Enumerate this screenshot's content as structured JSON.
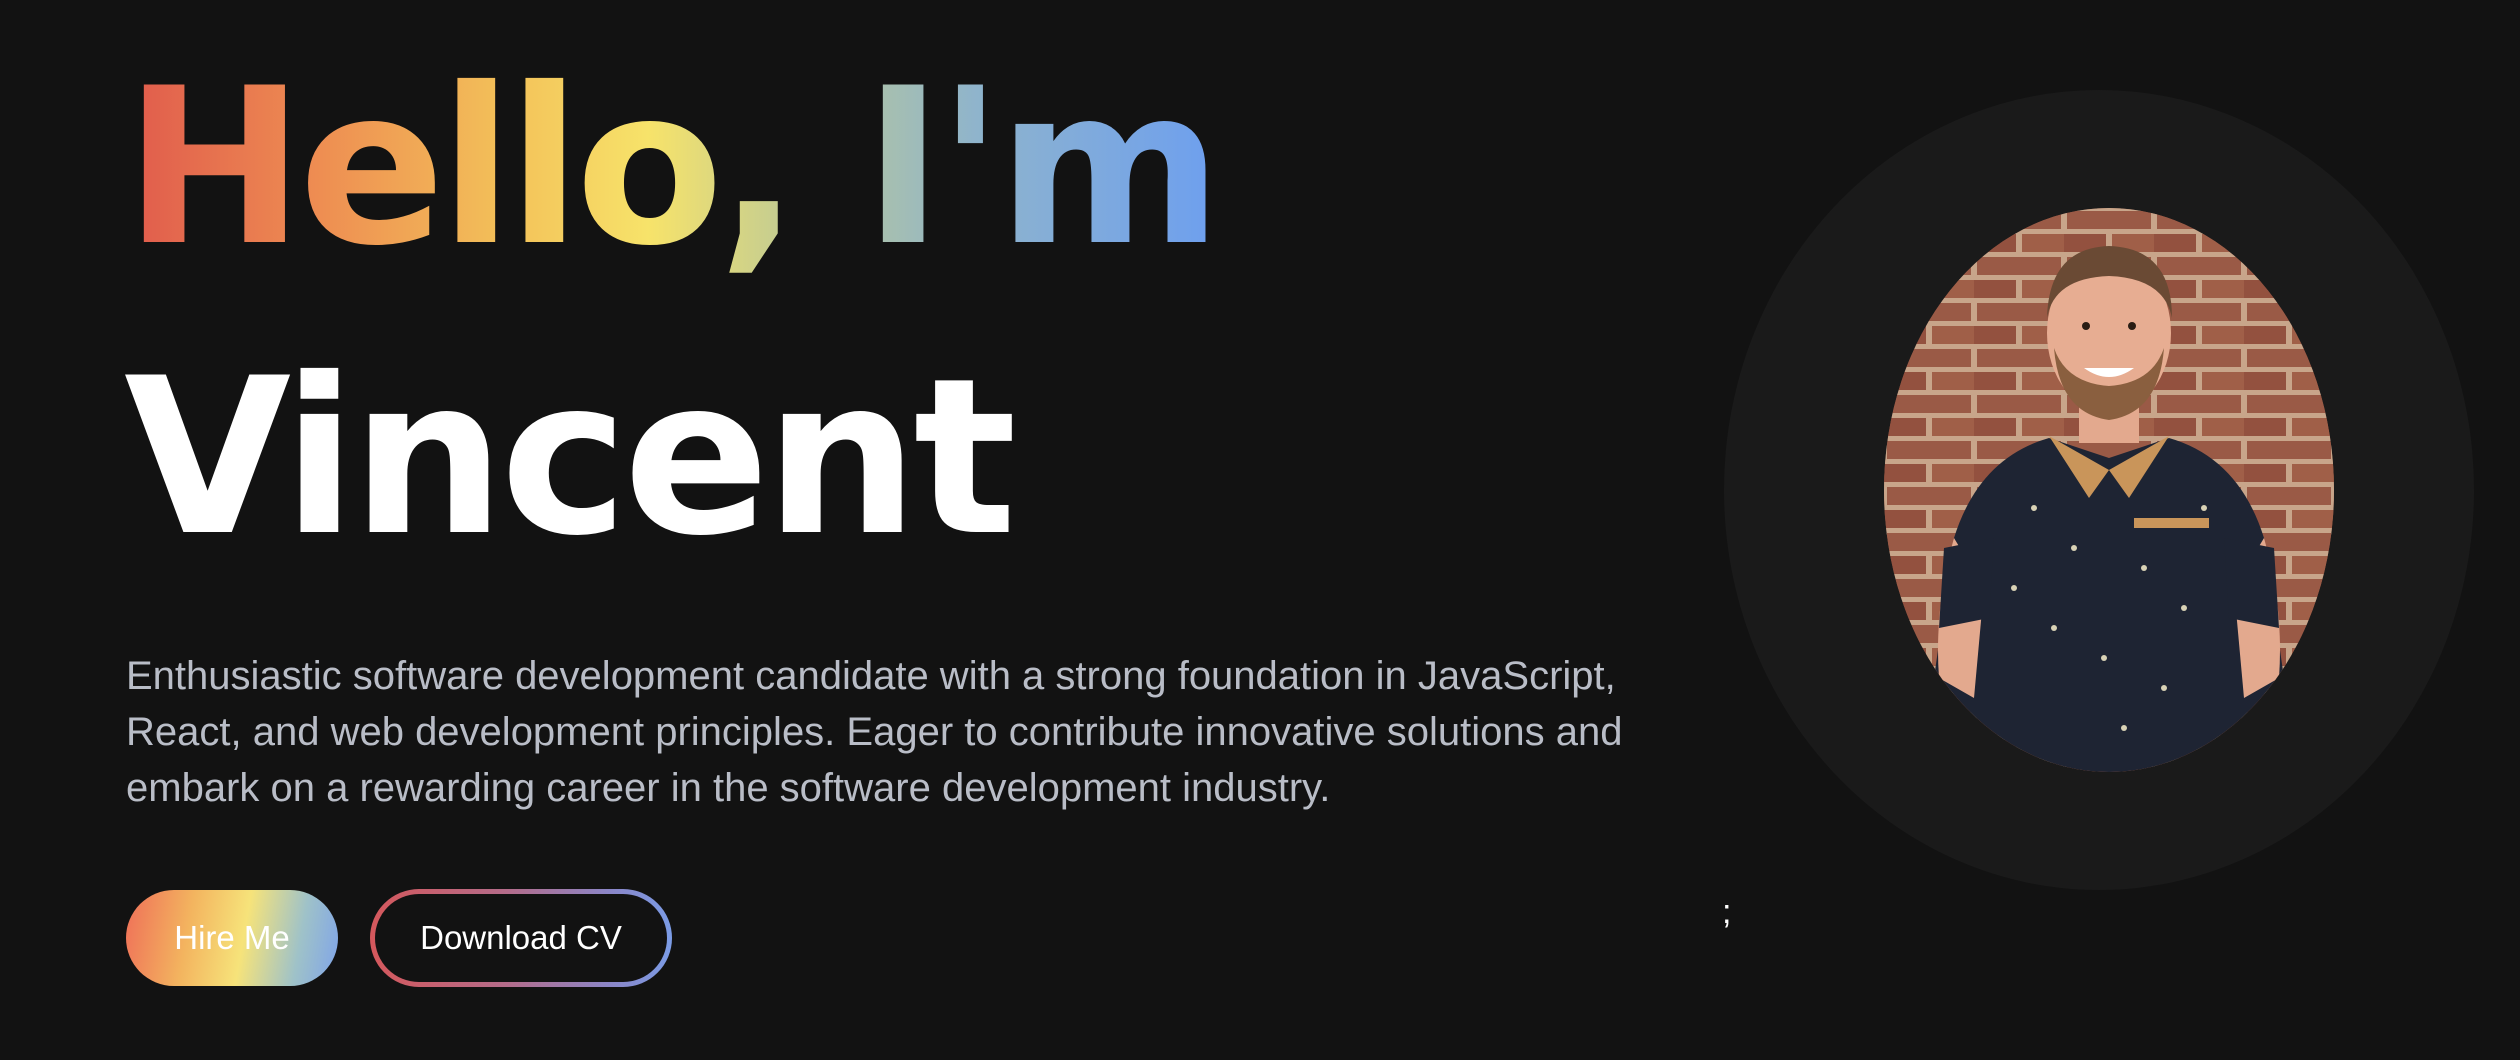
{
  "hero": {
    "greeting": "Hello, I'm",
    "name": "Vincent",
    "bio": "Enthusiastic software development candidate with a strong foundation in JavaScript, React, and web development principles. Eager to contribute innovative solutions and embark on a rewarding career in the software development industry.",
    "stray_text": ";"
  },
  "buttons": {
    "hire_label": "Hire Me",
    "download_label": "Download CV"
  },
  "profile_photo": {
    "alt": "Vincent"
  },
  "colors": {
    "background": "#121212",
    "photo_ring": "#1a1a1a",
    "bio_text": "#b9bdc7",
    "gradient": [
      "#e05a4c",
      "#ee8e52",
      "#f3c159",
      "#f7e36a",
      "#b9c89a",
      "#8fb4cc",
      "#6d9fef"
    ]
  }
}
